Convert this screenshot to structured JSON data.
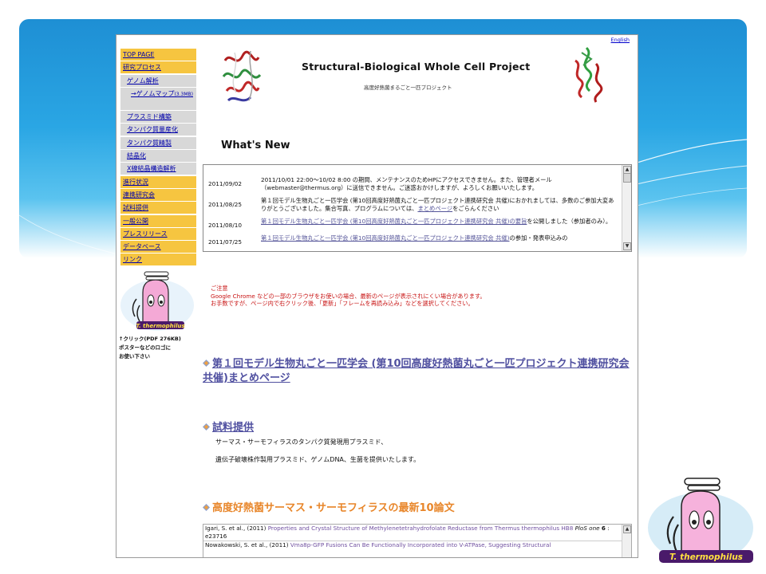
{
  "menu": {
    "items": [
      {
        "label": "TOP PAGE",
        "style": "y"
      },
      {
        "label": "研究プロセス",
        "style": "y"
      },
      {
        "label": "ゲノム解析",
        "style": "g"
      },
      {
        "label": "→ゲノムマップ",
        "size": "(3.3MB)",
        "style": "g tall"
      },
      {
        "label": "プラスミド構築",
        "style": "g"
      },
      {
        "label": "タンパク質量産化",
        "style": "g"
      },
      {
        "label": "タンパク質精製",
        "style": "g"
      },
      {
        "label": "結晶化",
        "style": "g"
      },
      {
        "label": "X線結晶構造解析",
        "style": "g"
      },
      {
        "label": "進行状況",
        "style": "y"
      },
      {
        "label": "連携研究会",
        "style": "y"
      },
      {
        "label": "試料提供",
        "style": "y"
      },
      {
        "label": "一般公開",
        "style": "y"
      },
      {
        "label": "プレスリリース",
        "style": "y"
      },
      {
        "label": "データベース",
        "style": "y"
      },
      {
        "label": "リンク",
        "style": "y"
      }
    ],
    "mascot_label": "T. thermophilus",
    "note_line1": "↑クリック(PDF 276KB)",
    "note_line2": "ポスターなどのロゴに",
    "note_line3": "お使い下さい"
  },
  "header": {
    "english_link": "English",
    "title": "Structural-Biological Whole Cell Project",
    "subtitle": "高度好熱菌まるごと一匹プロジェクト",
    "whats_new": "What's New"
  },
  "news": [
    {
      "date": "2011/09/02",
      "text": "2011/10/01 22:00〜10/02 8:00 の期間、メンテナンスのためHPにアクセスできません。また、管理者メール（webmaster@thermus.org）に送信できません。ご迷惑おかけしますが、よろしくお願いいたします。"
    },
    {
      "date": "2011/08/25",
      "text": "第１回モデル生物丸ごと一匹学会 (第10回高度好熱菌丸ごと一匹プロジェクト連携研究会 共催)におかれましては、多数のご参加大変ありがとうございました。集合写真、プログラムについては、",
      "link": "まとめページ",
      "text_after": "をごらんください"
    },
    {
      "date": "2011/08/10",
      "link": "第１回モデル生物丸ごと一匹学会 (第10回高度好熱菌丸ごと一匹プロジェクト連携研究会 共催)の要旨",
      "text_after": "を公開しました（参加者のみ）。"
    },
    {
      "date": "2011/07/25",
      "link": "第１回モデル生物丸ごと一匹学会 (第10回高度好熱菌丸ごと一匹プロジェクト連携研究会 共催)",
      "text_after": "の参加・発表申込みの"
    }
  ],
  "notice": {
    "line1": "ご注意",
    "line2": "Google Chrome などの一部のブラウザをお使いの場合、最新のページが表示されにくい場合があります。",
    "line3": "お手数ですが、ページ内で右クリック後、「更新」「フレームを再読み込み」などを選択してください。"
  },
  "sections": {
    "s1": "第１回モデル生物丸ごと一匹学会 (第10回高度好熱菌丸ごと一匹プロジェクト連携研究会 共催)まとめページ",
    "s2": "試料提供",
    "s2_line1": "サーマス・サーモフィラスのタンパク質発現用プラスミド、",
    "s2_line2": "遺伝子破壊株作製用プラスミド、ゲノムDNA、生菌を提供いたします。",
    "s3": "高度好熱菌サーマス・サーモフィラスの最新10論文"
  },
  "papers": [
    {
      "authors": "Igari, S. et al., (2011)",
      "title": "Properties and Crystal Structure of Methylenetetrahydrofolate Reductase from Thermus thermophilus HB8",
      "journal": "PloS one",
      "vol": "6",
      "page": "e23716"
    },
    {
      "authors": "Nowakowski, S. et al., (2011)",
      "title": "Vma8p-GFP Fusions Can Be Functionally Incorporated into V-ATPase, Suggesting Structural"
    }
  ],
  "mascot_big_label": "T. thermophilus",
  "colors": {
    "menu_yellow": "#f6c540",
    "menu_gray": "#d8d8d8",
    "section_link": "#5050a0",
    "section_orange": "#e8862a",
    "notice_red": "#c81414",
    "banner_blue": "#1e8fd4"
  }
}
